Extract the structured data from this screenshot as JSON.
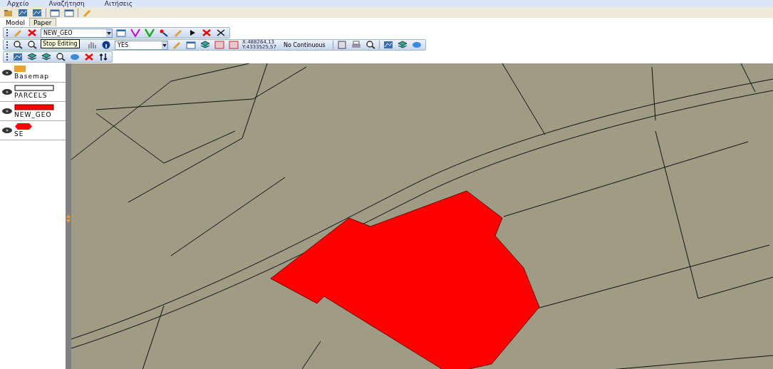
{
  "menu": [
    "Αρχείο",
    "Αναζήτηση",
    "Αιτήσεις"
  ],
  "tabs": [
    {
      "label": "Model",
      "selected": true
    },
    {
      "label": "Paper",
      "selected": false
    }
  ],
  "edit_toolbar": {
    "layer_combo": "NEW_GEO",
    "tooltip": "Stop Editing"
  },
  "view_toolbar": {
    "combo": "YES",
    "coord_x": "X:488264,13",
    "coord_y": "Y:4333525,57",
    "mode": "No Continuous"
  },
  "layers": [
    {
      "name": "Basemap",
      "kind": "picture"
    },
    {
      "name": "PARCELS",
      "kind": "outline"
    },
    {
      "name": "NEW_GEO",
      "kind": "fill"
    },
    {
      "name": "SE",
      "kind": "blob"
    }
  ]
}
